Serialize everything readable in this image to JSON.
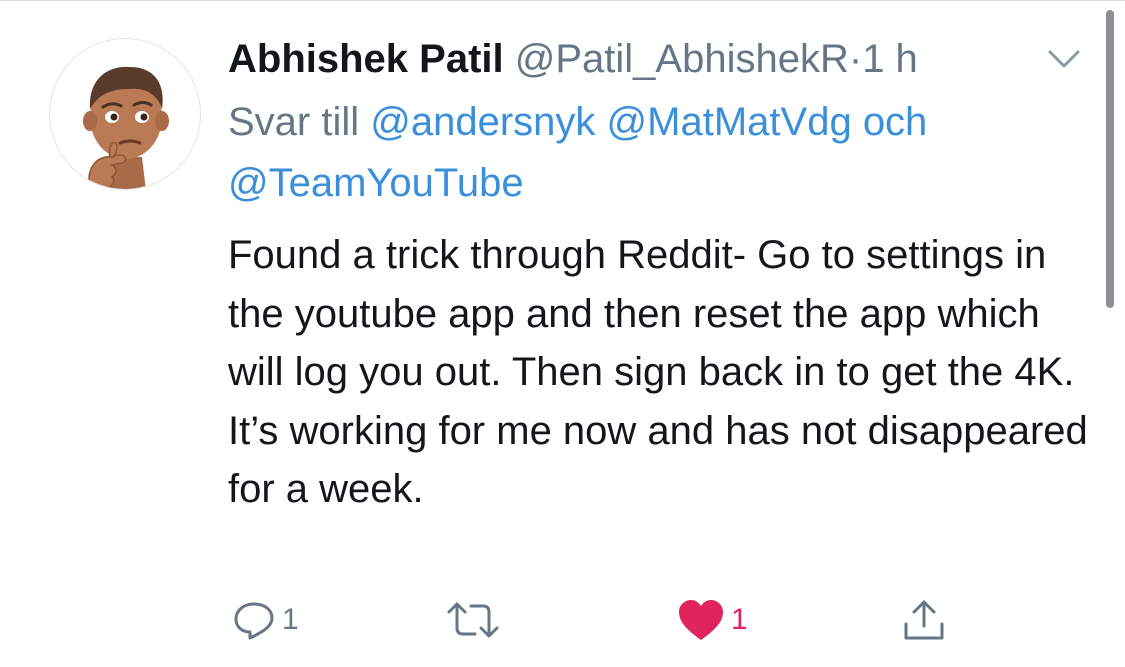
{
  "tweet": {
    "author_name": "Abhishek Patil",
    "handle": "@Patil_AbhishekR",
    "separator": "·",
    "time": "1 h",
    "reply_prefix": "Svar till",
    "mentions": [
      "@andersnyk",
      "@MatMatVdg"
    ],
    "mention_conjunction": "och",
    "mention_last": "@TeamYouTube",
    "body": "Found a trick through Reddit- Go to settings in the youtube app and then reset the app which will log you out. Then sign back in to get the 4K. It’s working for me now and has not disappeared for a week."
  },
  "actions": {
    "reply_count": "1",
    "retweet_count": "",
    "like_count": "1"
  },
  "icons": {
    "avatar": "thinking-face-memoji-avatar",
    "menu": "chevron-down-icon",
    "reply": "reply-bubble-icon",
    "retweet": "retweet-icon",
    "like": "heart-icon",
    "share": "share-icon"
  },
  "colors": {
    "text": "#14171a",
    "muted": "#657786",
    "link": "#3a8fdb",
    "like": "#e0245e"
  }
}
